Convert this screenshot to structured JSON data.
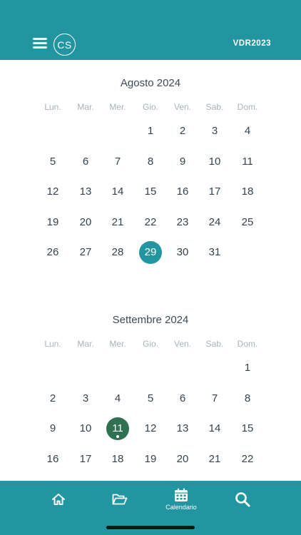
{
  "header": {
    "avatar_initials": "CS",
    "code": "VDR2023"
  },
  "weekdays": [
    "Lun.",
    "Mar.",
    "Mer.",
    "Gio.",
    "Ven.",
    "Sab.",
    "Dom."
  ],
  "months": [
    {
      "title": "Agosto 2024",
      "weeks": [
        [
          "",
          "",
          "",
          "1",
          "2",
          "3",
          "4"
        ],
        [
          "5",
          "6",
          "7",
          "8",
          "9",
          "10",
          "11"
        ],
        [
          "12",
          "13",
          "14",
          "15",
          "16",
          "17",
          "18"
        ],
        [
          "19",
          "20",
          "21",
          "22",
          "23",
          "24",
          "25"
        ],
        [
          "26",
          "27",
          "28",
          "29",
          "30",
          "31",
          ""
        ]
      ],
      "selected_day": "29"
    },
    {
      "title": "Settembre 2024",
      "weeks": [
        [
          "",
          "",
          "",
          "",
          "",
          "",
          "1"
        ],
        [
          "2",
          "3",
          "4",
          "5",
          "6",
          "7",
          "8"
        ],
        [
          "9",
          "10",
          "11",
          "12",
          "13",
          "14",
          "15"
        ],
        [
          "16",
          "17",
          "18",
          "19",
          "20",
          "21",
          "22"
        ]
      ],
      "today_day": "11"
    }
  ],
  "colors": {
    "accent": "#2196a1",
    "today": "#2f7150"
  },
  "tabbar": {
    "calendar_label": "Calendario"
  }
}
